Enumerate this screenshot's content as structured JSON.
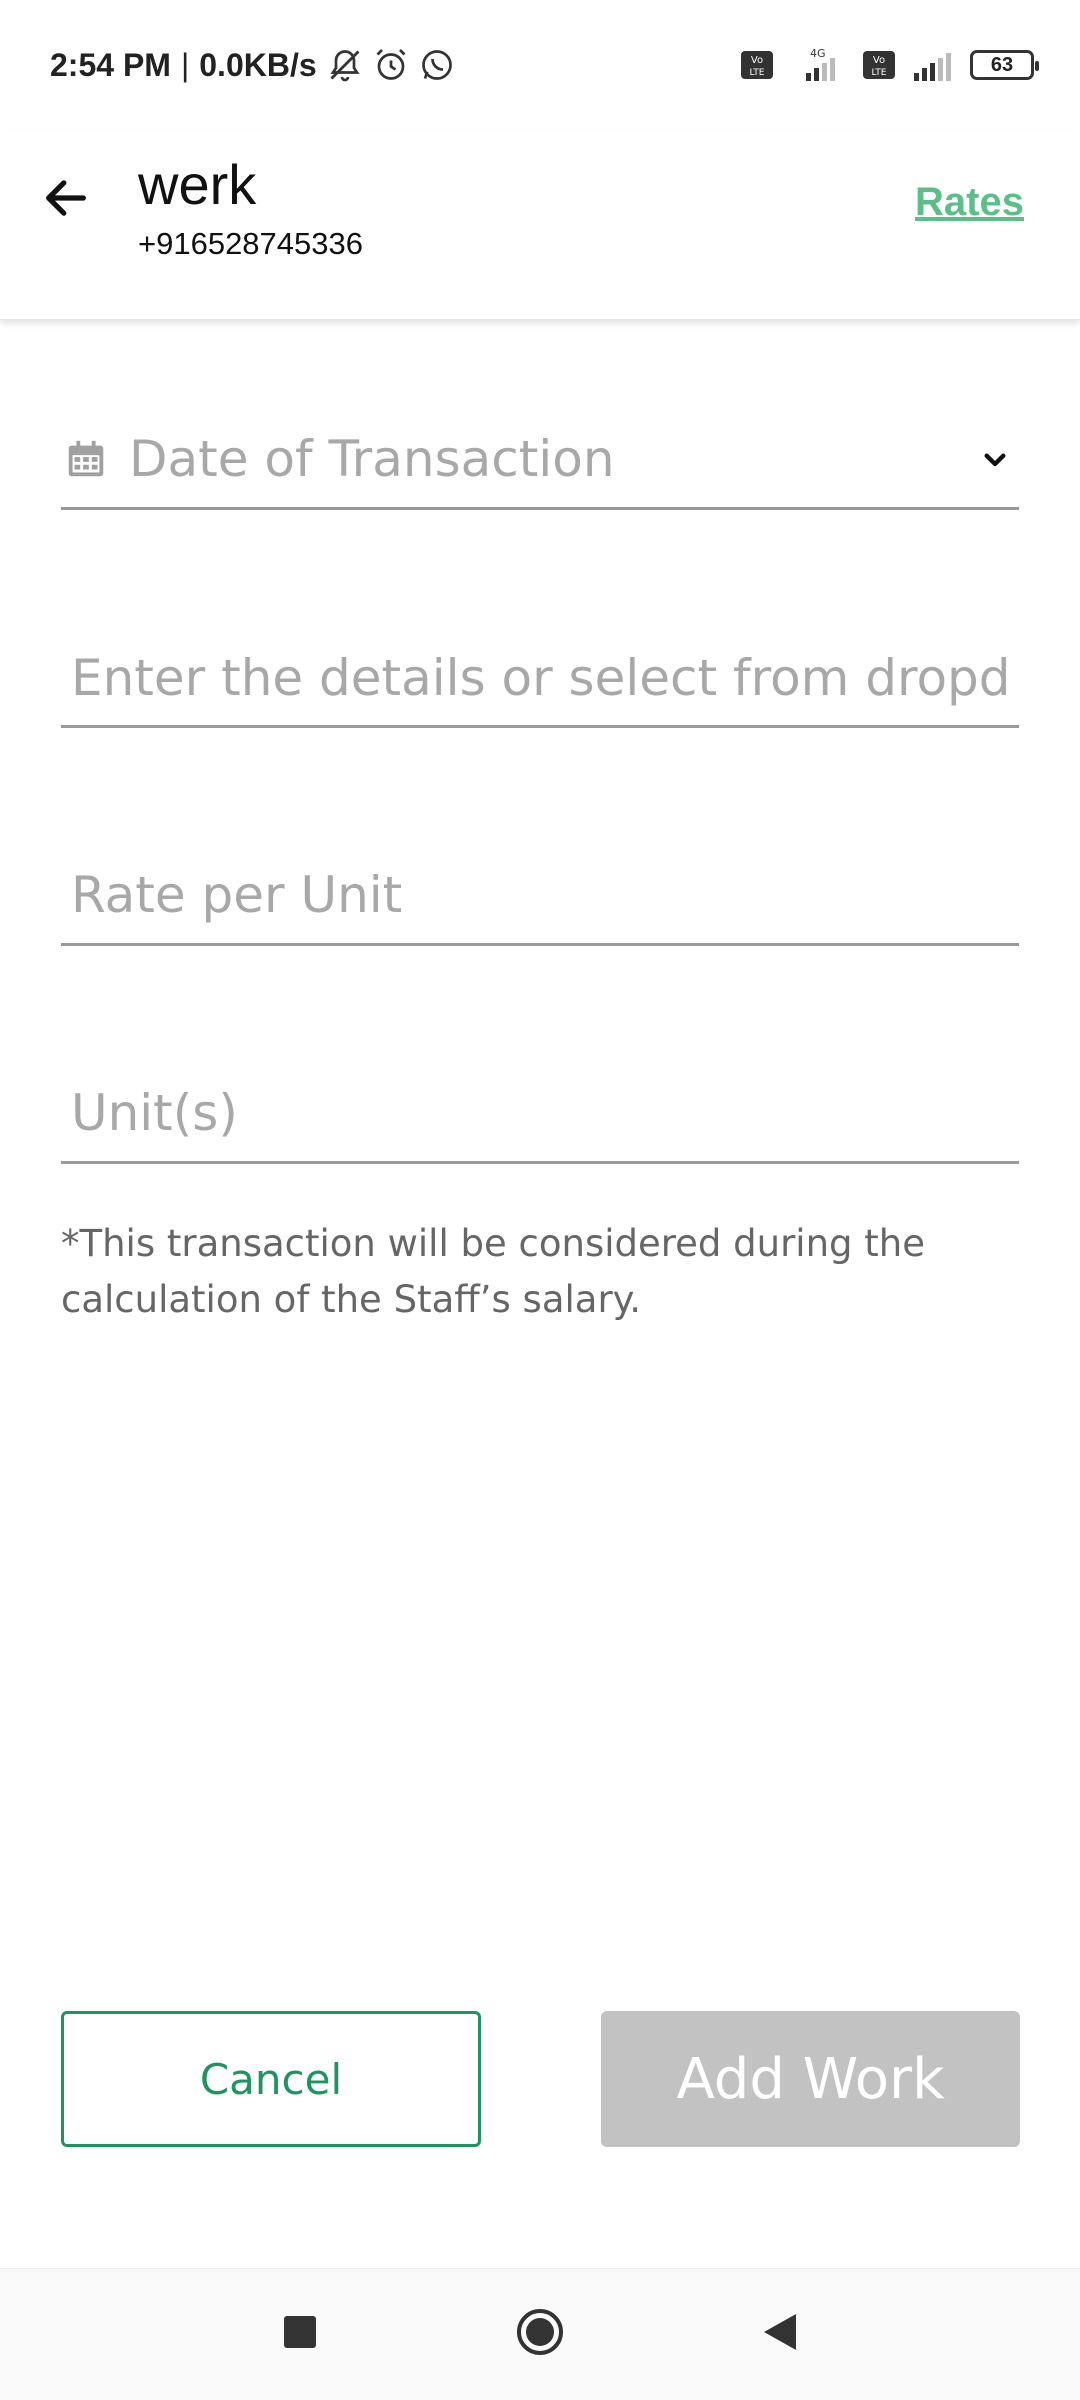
{
  "status_bar": {
    "time": "2:54 PM",
    "separator": "|",
    "speed": "0.0KB/s",
    "network_label": "4G",
    "volte_label": "Vo LTE",
    "battery": "63"
  },
  "header": {
    "title": "werk",
    "subtitle": "+916528745336",
    "rates_label": "Rates"
  },
  "form": {
    "date_placeholder": "Date of Transaction",
    "details_placeholder": "Enter the details or select from dropdown",
    "rate_placeholder": "Rate per Unit",
    "units_placeholder": "Unit(s)",
    "note": "*This transaction will be considered during the calculation of the Staff’s salary."
  },
  "buttons": {
    "cancel_label": "Cancel",
    "add_label": "Add Work"
  },
  "colors": {
    "accent_green": "#1e9460",
    "rates_green": "#5cbf8a",
    "disabled_gray": "#c2c2c2"
  },
  "icons": {
    "back": "arrow-left-icon",
    "calendar": "calendar-icon",
    "dropdown": "chevron-down-icon",
    "nav_recent": "square-icon",
    "nav_home": "circle-icon",
    "nav_back": "triangle-back-icon"
  }
}
